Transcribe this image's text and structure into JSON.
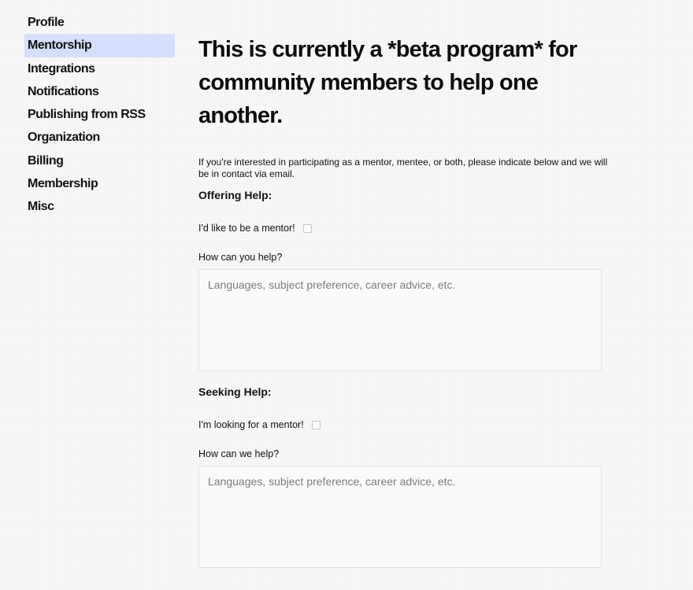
{
  "sidebar": {
    "items": [
      {
        "label": "Profile",
        "active": false
      },
      {
        "label": "Mentorship",
        "active": true
      },
      {
        "label": "Integrations",
        "active": false
      },
      {
        "label": "Notifications",
        "active": false
      },
      {
        "label": "Publishing from RSS",
        "active": false
      },
      {
        "label": "Organization",
        "active": false
      },
      {
        "label": "Billing",
        "active": false
      },
      {
        "label": "Membership",
        "active": false
      },
      {
        "label": "Misc",
        "active": false
      }
    ]
  },
  "main": {
    "heading": "This is currently a *beta program* for community members to help one another.",
    "intro": "If you're interested in participating as a mentor, mentee, or both, please indicate below and we will be in contact via email.",
    "offering": {
      "title": "Offering Help:",
      "checkbox_label": "I'd like to be a mentor!",
      "checked": false,
      "question": "How can you help?",
      "placeholder": "Languages, subject preference, career advice, etc."
    },
    "seeking": {
      "title": "Seeking Help:",
      "checkbox_label": "I'm looking for a mentor!",
      "checked": false,
      "question": "How can we help?",
      "placeholder": "Languages, subject preference, career advice, etc."
    }
  },
  "colors": {
    "active_nav_background": "#d5defa",
    "page_background": "#f7f7f7",
    "input_border": "#e0e0e0"
  }
}
